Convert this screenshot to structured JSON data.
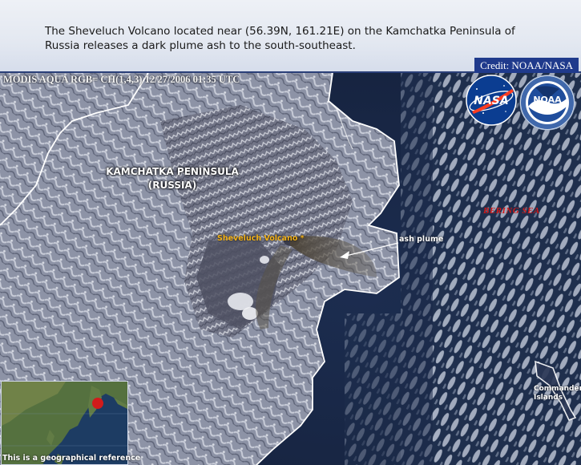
{
  "header": {
    "caption": "The Sheveluch Volcano located near (56.39N, 161.21E) on the Kamchatka Peninsula of Russia releases a dark plume ash to the south-southeast.",
    "credit": "Credit: NOAA/NASA"
  },
  "image": {
    "modis_label": "MODIS AQUA RGB= CH(1,4,3) 12/27/2006 01:35 UTC",
    "region_line1": "KAMCHATKA PENINSULA",
    "region_line2": "(RUSSIA)",
    "volcano_label": "Sheveluch Volcano *",
    "plume_label": "ash plume",
    "sea_label": "BERING SEA",
    "islands_line1": "Commander",
    "islands_line2": "Islands"
  },
  "inset": {
    "caption": "This is a geographical reference"
  },
  "logos": {
    "nasa": "NASA",
    "noaa": "NOAA",
    "nasa_icon": "nasa-meatball-logo",
    "noaa_icon": "noaa-seal-logo"
  },
  "colors": {
    "credit_bg": "#1f3a8c",
    "volcano_label": "#f3b21a",
    "sea_label": "#d01818",
    "coastline": "#ffffff"
  }
}
